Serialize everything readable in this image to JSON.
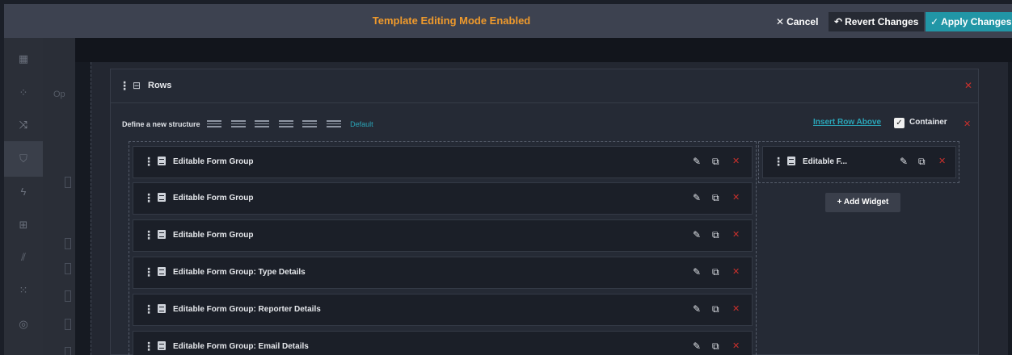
{
  "topbar": {
    "title": "Template Editing Mode Enabled",
    "cancel_label": "Cancel",
    "revert_label": "Revert Changes",
    "apply_label": "Apply Changes"
  },
  "underlay": {
    "text": "Op"
  },
  "rows": {
    "label": "Rows",
    "define_label": "Define a new structure",
    "default_label": "Default",
    "insert_row_above": "Insert Row Above",
    "container_label": "Container"
  },
  "widgets": [
    {
      "label": "Editable Form Group"
    },
    {
      "label": "Editable Form Group"
    },
    {
      "label": "Editable Form Group"
    },
    {
      "label": "Editable Form Group: Type Details"
    },
    {
      "label": "Editable Form Group: Reporter Details"
    },
    {
      "label": "Editable Form Group: Email Details"
    }
  ],
  "right_widget": {
    "label": "Editable F..."
  },
  "add_widget_label": "Add Widget",
  "colors": {
    "accent": "#2196a6",
    "title": "#ef9a2c",
    "delete": "#c9302c"
  }
}
